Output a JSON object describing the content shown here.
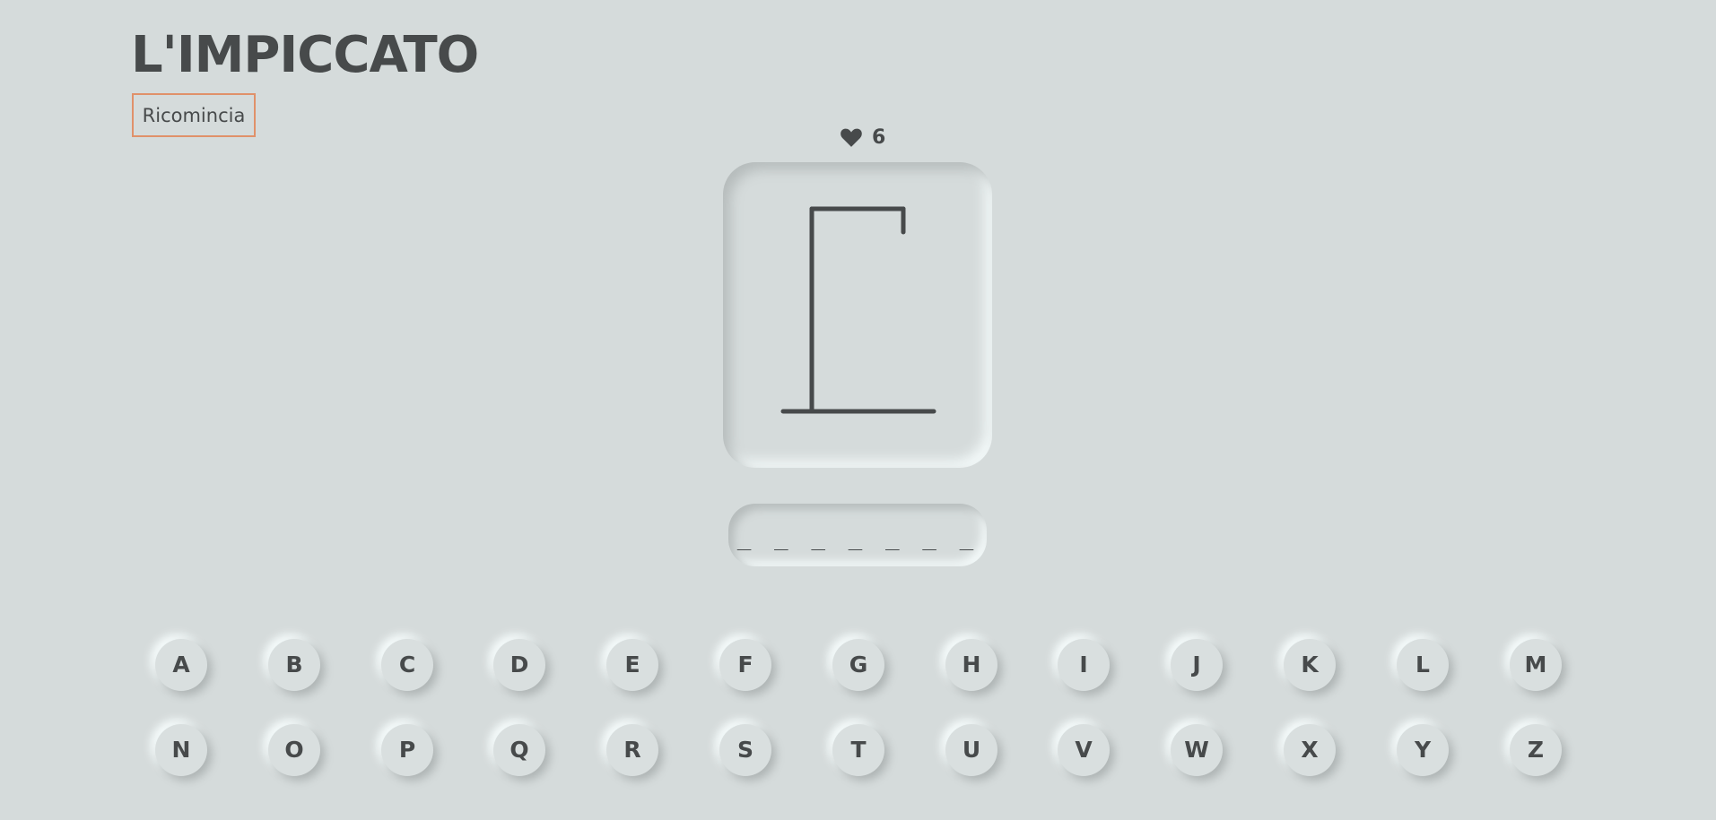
{
  "header": {
    "title": "L'IMPICCATO",
    "restart_label": "Ricomincia"
  },
  "status": {
    "lives": "6",
    "lives_icon": "heart-icon"
  },
  "word": {
    "display": "_ _ _ _ _ _ _"
  },
  "hangman": {
    "parts_drawn": [
      "base",
      "pole",
      "beam",
      "rope"
    ]
  },
  "keyboard": {
    "row1": [
      "A",
      "B",
      "C",
      "D",
      "E",
      "F",
      "G",
      "H",
      "I",
      "J",
      "K",
      "L",
      "M"
    ],
    "row2": [
      "N",
      "O",
      "P",
      "Q",
      "R",
      "S",
      "T",
      "U",
      "V",
      "W",
      "X",
      "Y",
      "Z"
    ]
  },
  "colors": {
    "background": "#d5dbdb",
    "text": "#474a4b",
    "restart_border": "#e0916a"
  }
}
